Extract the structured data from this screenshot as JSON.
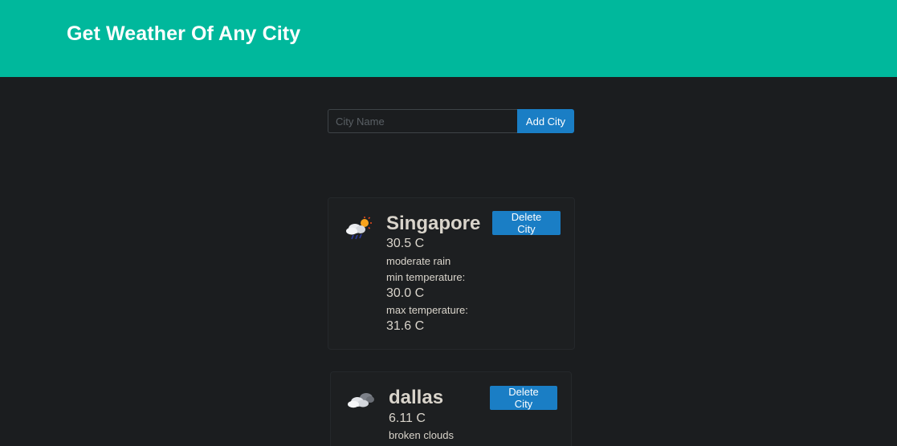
{
  "header": {
    "title": "Get Weather Of Any City"
  },
  "search": {
    "placeholder": "City Name",
    "value": "",
    "add_label": "Add City"
  },
  "cities": [
    {
      "icon": "cloud-sun-rain-icon",
      "name": "Singapore",
      "temperature": "30.5 C",
      "description": "moderate rain",
      "min_label": "min temperature:",
      "min_temperature": "30.0 C",
      "max_label": "max temperature:",
      "max_temperature": "31.6 C",
      "delete_label": "Delete City"
    },
    {
      "icon": "broken-clouds-icon",
      "name": "dallas",
      "temperature": "6.11 C",
      "description": "broken clouds",
      "delete_label": "Delete City"
    }
  ],
  "colors": {
    "hero_bg": "#00b89c",
    "page_bg": "#1b1d1f",
    "button": "#1a7ec5",
    "text": "#d9d4cb"
  }
}
